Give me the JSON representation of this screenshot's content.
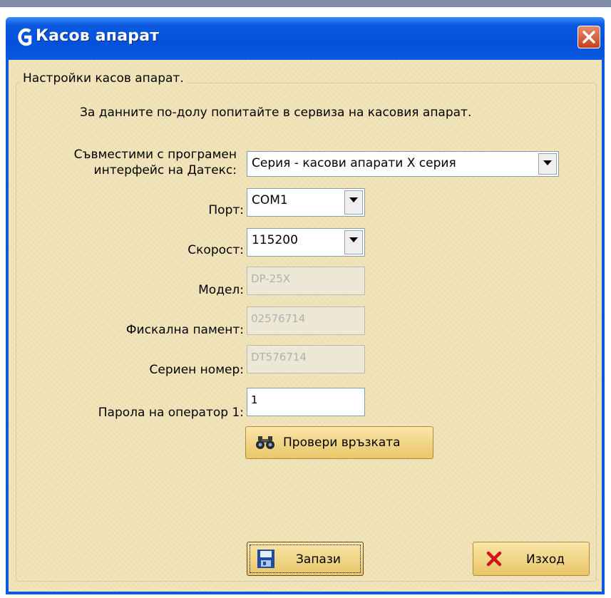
{
  "window": {
    "title": "Касов апарат",
    "app_icon": "app-logo-icon",
    "close_icon": "close-icon"
  },
  "group": {
    "caption": "Настройки касов апарат."
  },
  "info_text": "За данните по-долу попитайте в сервиза на касовия апарат.",
  "fields": {
    "interface": {
      "label_line1": "Съвместими с програмен",
      "label_line2": "интерфейс на Датекс:",
      "value": "Серия - касови апарати X серия"
    },
    "port": {
      "label": "Порт:",
      "value": "COM1"
    },
    "speed": {
      "label": "Скорост:",
      "value": "115200"
    },
    "model": {
      "label": "Модел:",
      "value": "DP-25X"
    },
    "fiscal_memory": {
      "label": "Фискална памент:",
      "value": "02576714"
    },
    "serial_number": {
      "label": "Сериен номер:",
      "value": "DT576714"
    },
    "operator_password": {
      "label": "Парола на оператор 1:",
      "value": "1"
    }
  },
  "buttons": {
    "check_connection": {
      "label": "Провери връзката",
      "icon": "binoculars-icon"
    },
    "save": {
      "label": "Запази",
      "icon": "floppy-disk-icon"
    },
    "exit": {
      "label": "Изход",
      "icon": "red-x-icon"
    }
  },
  "colors": {
    "title_bar": "#0a5ae0",
    "client_bg": "#f1e3b8",
    "button_bg": "#e9c669",
    "close_button": "#c6401c"
  }
}
